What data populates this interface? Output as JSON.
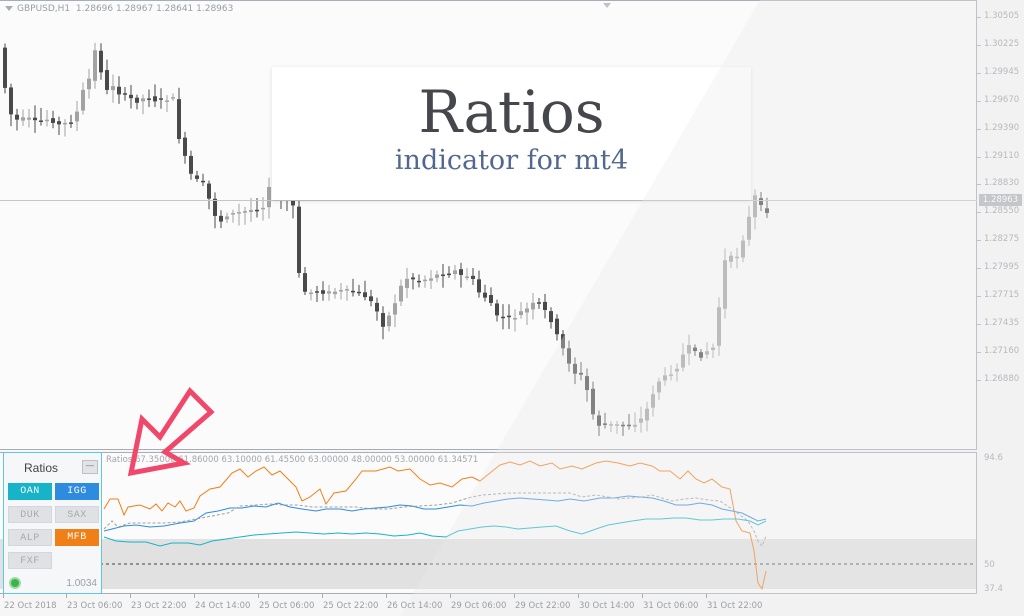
{
  "header": {
    "symbol": "GBPUSD,H1",
    "ohlc": "1.28696 1.28967 1.28641 1.28963"
  },
  "price_axis": {
    "labels": [
      "1.30505",
      "1.30225",
      "1.29945",
      "1.29670",
      "1.29390",
      "1.29110",
      "1.28830",
      "1.28550",
      "1.28275",
      "1.27995",
      "1.27715",
      "1.27435",
      "1.27160",
      "1.26880"
    ],
    "bid": "1.28963"
  },
  "overlay": {
    "title": "Ratios",
    "subtitle": "indicator for mt4"
  },
  "indicator": {
    "header": "Ratios 67.35000 61.86000 63.10000 61.45500 63.00000 48.00000 53.00000 61.34571",
    "axis_labels": {
      "max": "94.6",
      "mid": "50",
      "min": "37.4"
    }
  },
  "panel": {
    "title": "Ratios",
    "minimize_label": "—",
    "buttons": [
      {
        "label": "OAN",
        "state": "on",
        "color": "#17b3c9"
      },
      {
        "label": "IGG",
        "state": "on",
        "color": "#2d8be0"
      },
      {
        "label": "DUK",
        "state": "off"
      },
      {
        "label": "SAX",
        "state": "off"
      },
      {
        "label": "ALP",
        "state": "off"
      },
      {
        "label": "MFB",
        "state": "on",
        "color": "#f07f17"
      },
      {
        "label": "FXF",
        "state": "off"
      }
    ],
    "status": "connected",
    "value": "1.0034"
  },
  "time_axis": {
    "labels": [
      "22 Oct 2018",
      "23 Oct 06:00",
      "23 Oct 22:00",
      "24 Oct 14:00",
      "25 Oct 06:00",
      "25 Oct 22:00",
      "26 Oct 14:00",
      "29 Oct 06:00",
      "29 Oct 22:00",
      "30 Oct 14:00",
      "31 Oct 06:00",
      "31 Oct 22:00"
    ]
  },
  "colors": {
    "bull": "#a3a3a3",
    "bear": "#4a4a4a",
    "oan": "#17b3c9",
    "igg": "#2d8be0",
    "mfb": "#f07f17",
    "avg": "#a0a0a0",
    "arrow": "#f0476a"
  }
}
